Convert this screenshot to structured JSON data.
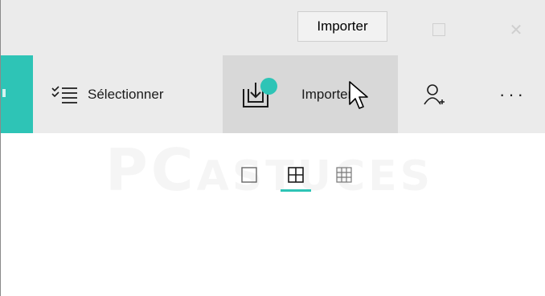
{
  "tooltip": {
    "text": "Importer"
  },
  "window_controls": {
    "maximize_icon": "maximize-icon",
    "close_icon": "close-icon",
    "close_glyph": "✕"
  },
  "toolbar": {
    "select": {
      "label": "Sélectionner",
      "icon": "checklist-icon"
    },
    "import": {
      "label": "Importer",
      "icon": "import-icon"
    },
    "people": {
      "icon": "add-person-icon"
    },
    "more": {
      "label": "···",
      "icon": "more-icon"
    }
  },
  "view_options": {
    "items": [
      {
        "icon": "single-view-icon"
      },
      {
        "icon": "grid-4-view-icon",
        "selected": true
      },
      {
        "icon": "grid-9-view-icon"
      }
    ]
  },
  "watermark": {
    "text_main": "PC",
    "text_rest": "ASTUCES"
  },
  "colors": {
    "accent": "#2ec4b6",
    "toolbar_bg": "#ebebeb",
    "hover_bg": "#d8d8d8"
  }
}
